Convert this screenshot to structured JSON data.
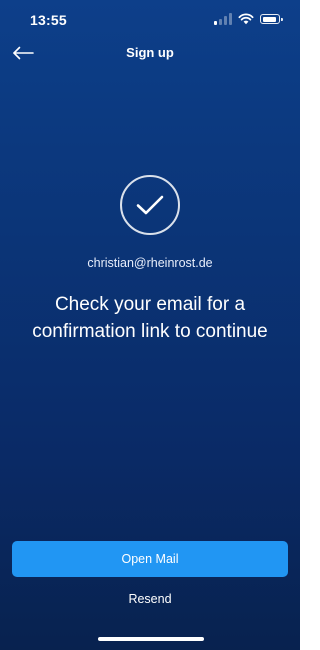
{
  "status_bar": {
    "time": "13:55",
    "icons": [
      "cellular-signal-icon",
      "wifi-icon",
      "battery-icon"
    ]
  },
  "header": {
    "back_icon": "arrow-left-icon",
    "title": "Sign up"
  },
  "confirmation": {
    "icon": "checkmark-circle-icon",
    "email": "christian@rheinrost.de",
    "message": "Check your email for a confirmation link to continue"
  },
  "actions": {
    "open_mail_label": "Open Mail",
    "resend_label": "Resend"
  },
  "colors": {
    "background_top": "#0d3f8a",
    "background_bottom": "#08224f",
    "primary_button": "#2196f3",
    "text": "#ffffff"
  }
}
